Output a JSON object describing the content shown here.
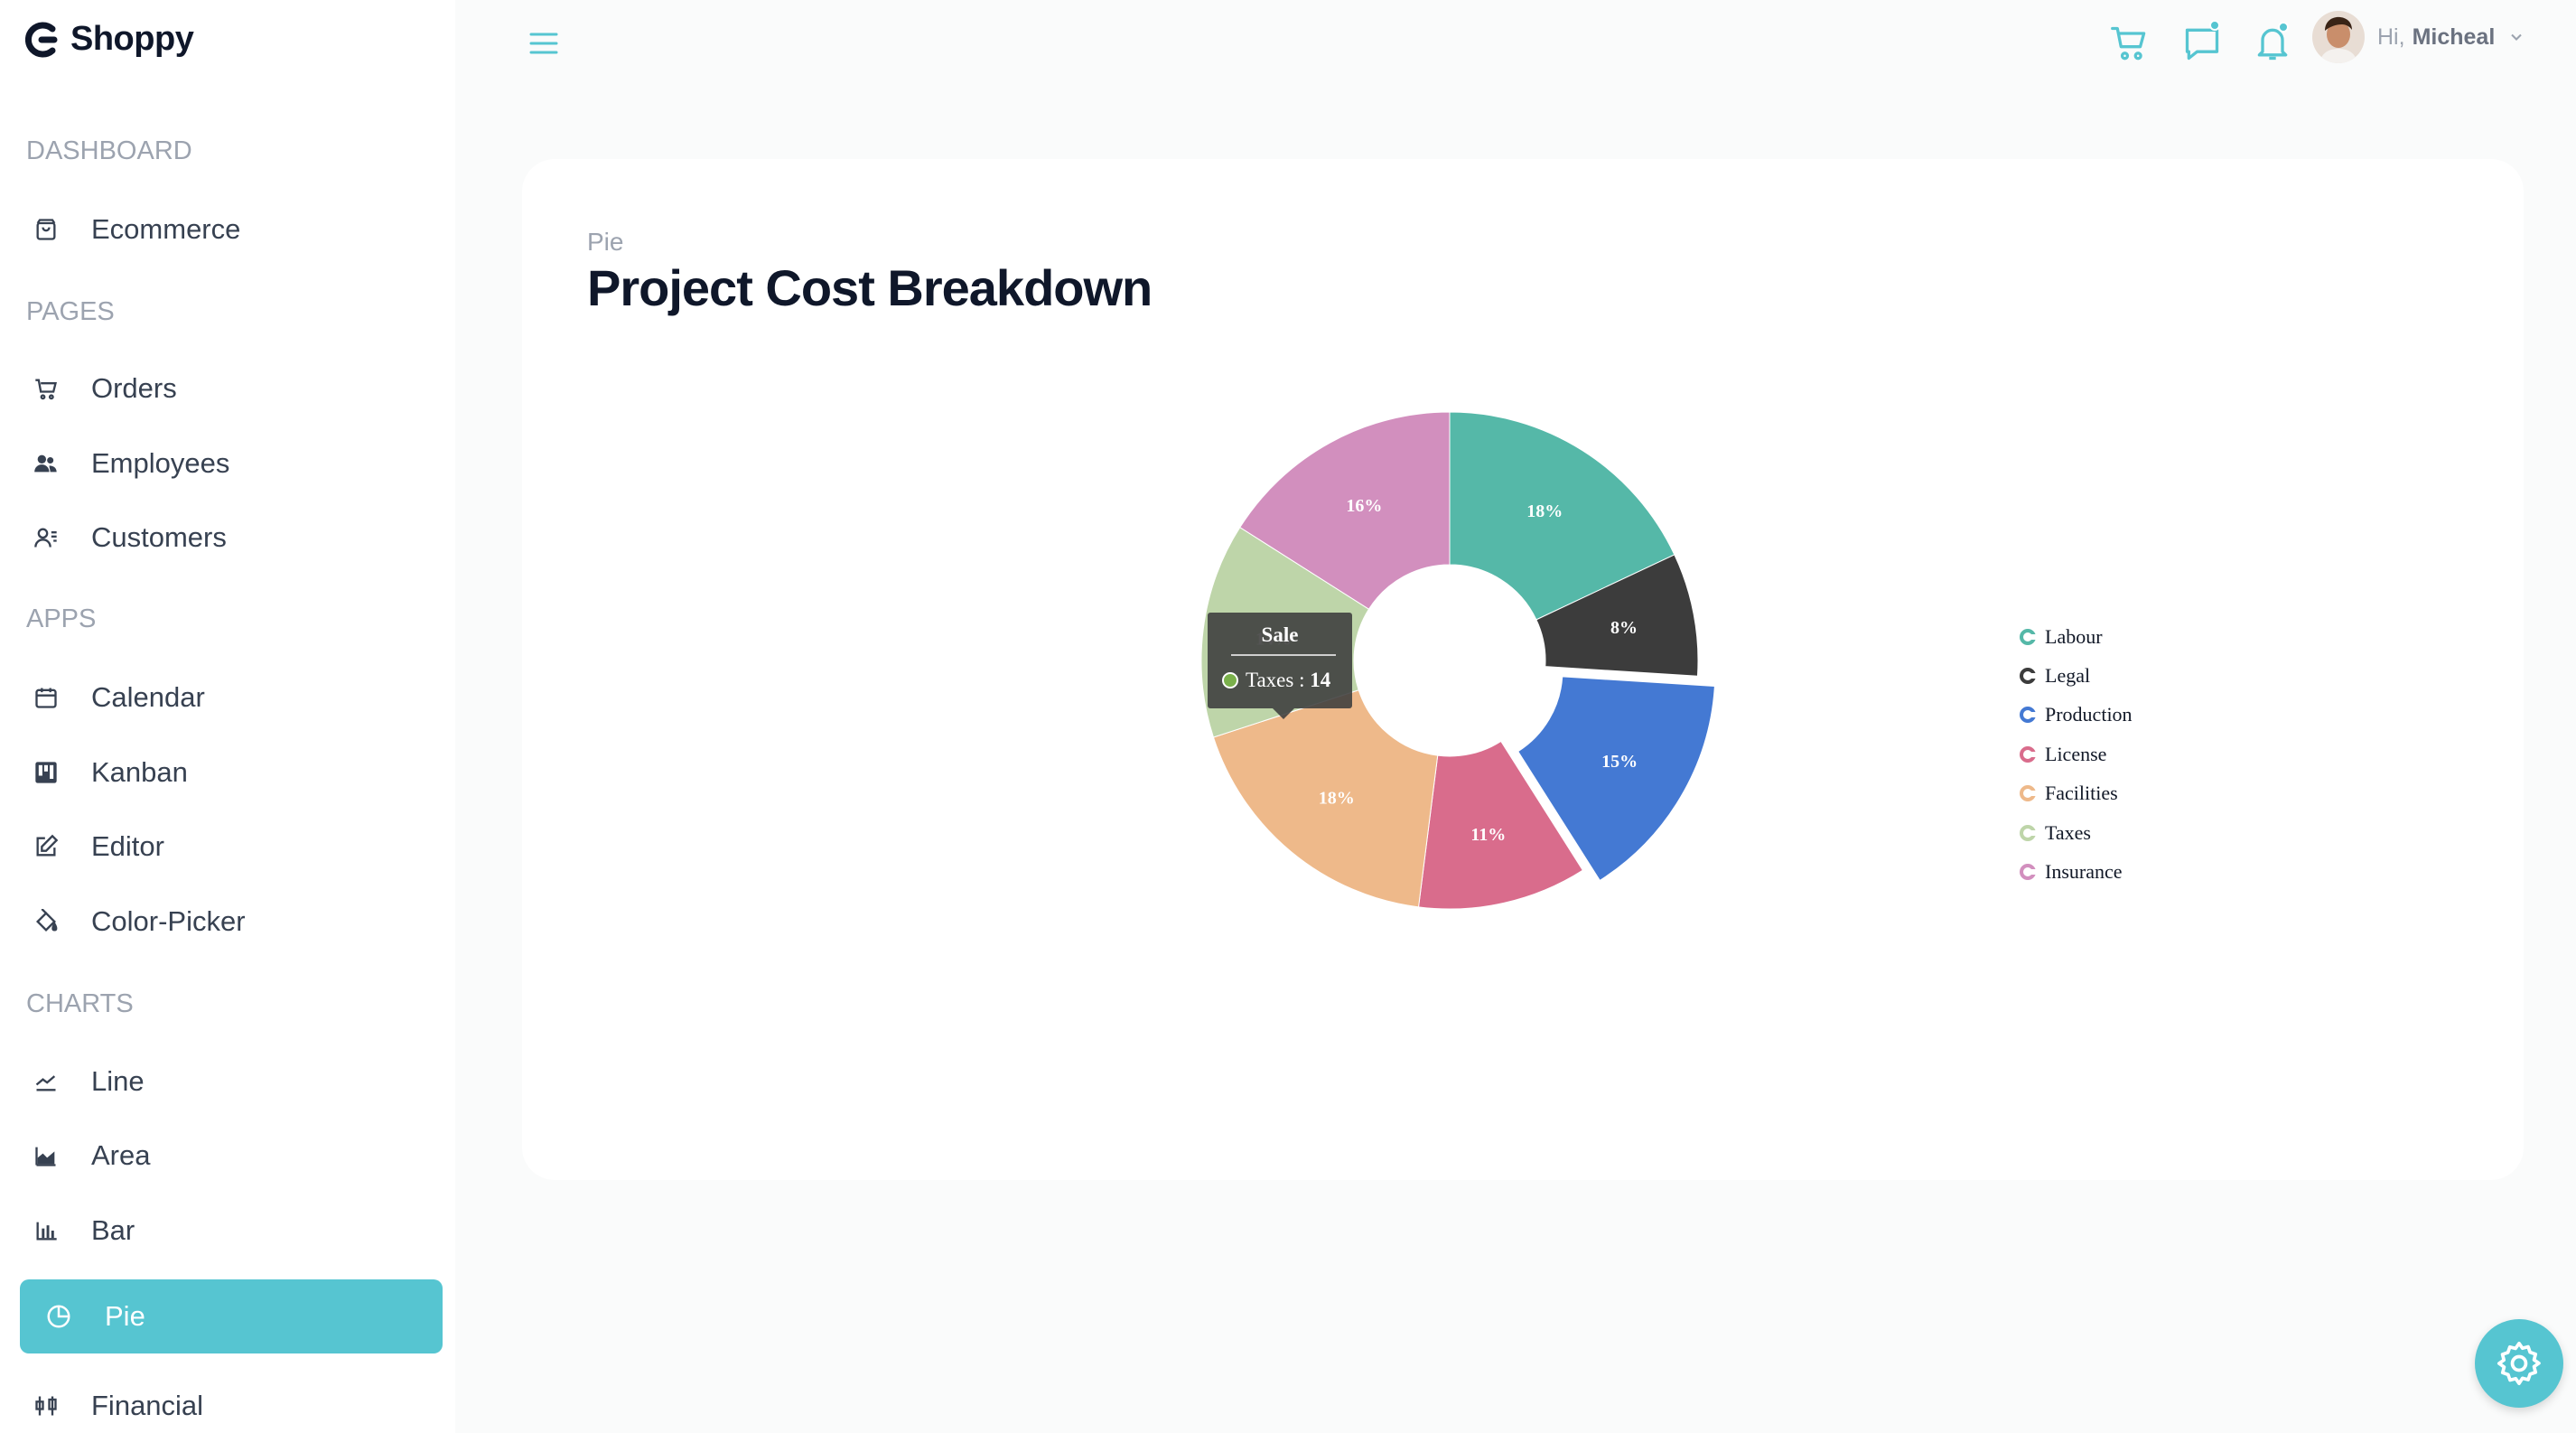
{
  "app": {
    "brand": "Shoppy"
  },
  "sidebar": {
    "sections": [
      {
        "title": "DASHBOARD",
        "items": [
          {
            "label": "Ecommerce",
            "icon": "shopping-bag-icon"
          }
        ]
      },
      {
        "title": "PAGES",
        "items": [
          {
            "label": "Orders",
            "icon": "cart-icon"
          },
          {
            "label": "Employees",
            "icon": "people-icon"
          },
          {
            "label": "Customers",
            "icon": "contacts-icon"
          }
        ]
      },
      {
        "title": "APPS",
        "items": [
          {
            "label": "Calendar",
            "icon": "calendar-icon"
          },
          {
            "label": "Kanban",
            "icon": "kanban-icon"
          },
          {
            "label": "Editor",
            "icon": "edit-icon"
          },
          {
            "label": "Color-Picker",
            "icon": "paint-bucket-icon"
          }
        ]
      },
      {
        "title": "CHARTS",
        "items": [
          {
            "label": "Line",
            "icon": "line-chart-icon"
          },
          {
            "label": "Area",
            "icon": "area-chart-icon"
          },
          {
            "label": "Bar",
            "icon": "bar-chart-icon"
          },
          {
            "label": "Pie",
            "icon": "pie-chart-icon",
            "active": true
          },
          {
            "label": "Financial",
            "icon": "financial-icon"
          }
        ]
      }
    ]
  },
  "topbar": {
    "greeting": "Hi,",
    "user_name": "Micheal",
    "notification_dots": [
      "chat",
      "notifications"
    ]
  },
  "page": {
    "subtitle": "Pie",
    "title": "Project Cost Breakdown"
  },
  "colors": {
    "accent": "#56c5d1",
    "labour": "#55b8a8",
    "legal": "#3c3c3c",
    "production": "#4479d3",
    "license": "#d96c8c",
    "facilities": "#eeb98a",
    "taxes": "#bed5a9",
    "insurance": "#d28fbe"
  },
  "chart_data": {
    "type": "pie",
    "donut": true,
    "title": "",
    "legend_position": "right",
    "slices": [
      {
        "name": "Labour",
        "value": 18,
        "label": "18%",
        "color": "#55b8a8"
      },
      {
        "name": "Legal",
        "value": 8,
        "label": "8%",
        "color": "#3c3c3c"
      },
      {
        "name": "Production",
        "value": 15,
        "label": "15%",
        "color": "#4479d3",
        "exploded": true
      },
      {
        "name": "License",
        "value": 11,
        "label": "11%",
        "color": "#d96c8c"
      },
      {
        "name": "Facilities",
        "value": 18,
        "label": "18%",
        "color": "#eeb98a"
      },
      {
        "name": "Taxes",
        "value": 14,
        "label": "14%",
        "color": "#bed5a9"
      },
      {
        "name": "Insurance",
        "value": 16,
        "label": "16%",
        "color": "#d28fbe"
      }
    ],
    "tooltip": {
      "header": "Sale",
      "series": "Taxes",
      "separator": " : ",
      "value": "14"
    }
  }
}
